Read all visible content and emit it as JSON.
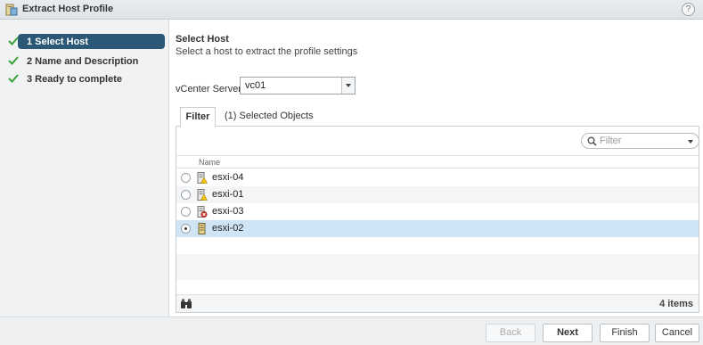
{
  "window": {
    "title": "Extract Host Profile",
    "help_label": "?"
  },
  "steps": [
    {
      "label": "1 Select Host",
      "active": true
    },
    {
      "label": "2 Name and Description",
      "active": false
    },
    {
      "label": "3 Ready to complete",
      "active": false
    }
  ],
  "section": {
    "title": "Select Host",
    "subtitle": "Select a host to extract the profile settings"
  },
  "vcenter": {
    "label": "vCenter Server:",
    "value": "vc01"
  },
  "tabs": [
    {
      "label": "Filter"
    },
    {
      "label": "(1) Selected Objects"
    }
  ],
  "filter": {
    "placeholder": "Filter"
  },
  "table": {
    "column": "Name",
    "rows": [
      {
        "name": "esxi-04",
        "selected": false,
        "status": "warning"
      },
      {
        "name": "esxi-01",
        "selected": false,
        "status": "warning"
      },
      {
        "name": "esxi-03",
        "selected": false,
        "status": "error"
      },
      {
        "name": "esxi-02",
        "selected": true,
        "status": "normal"
      }
    ],
    "count": "4 items"
  },
  "buttons": {
    "back": "Back",
    "next": "Next",
    "finish": "Finish",
    "cancel": "Cancel"
  },
  "colors": {
    "accent": "#2b5876",
    "selected_row": "#cfe5f5",
    "check": "#3aa13a"
  }
}
